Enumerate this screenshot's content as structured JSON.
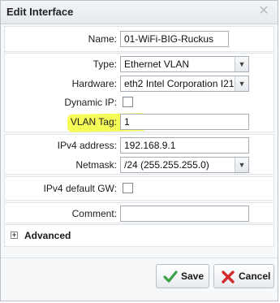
{
  "dialog": {
    "title": "Edit Interface",
    "close_glyph": "✕"
  },
  "fields": {
    "name": {
      "label": "Name:",
      "value": "01-WiFi-BIG-Ruckus"
    },
    "type": {
      "label": "Type:",
      "value": "Ethernet VLAN"
    },
    "hardware": {
      "label": "Hardware:",
      "value": "eth2 Intel Corporation I21"
    },
    "dynamic_ip": {
      "label": "Dynamic IP:",
      "checked": false
    },
    "vlan_tag": {
      "label": "VLAN Tag:",
      "value": "1"
    },
    "ipv4_address": {
      "label": "IPv4 address:",
      "value": "192.168.9.1"
    },
    "netmask": {
      "label": "Netmask:",
      "value": "/24 (255.255.255.0)"
    },
    "ipv4_default_gw": {
      "label": "IPv4 default GW:",
      "checked": false
    },
    "comment": {
      "label": "Comment:",
      "value": ""
    }
  },
  "advanced": {
    "label": "Advanced",
    "toggle_glyph": "+"
  },
  "buttons": {
    "save": "Save",
    "cancel": "Cancel"
  },
  "icons": {
    "save": "check-icon",
    "cancel": "x-icon",
    "dropdown": "chevron-down-icon"
  },
  "colors": {
    "highlight": "#f3fb3a",
    "save_icon": "#3aa14a",
    "cancel_icon": "#d12b2b"
  }
}
